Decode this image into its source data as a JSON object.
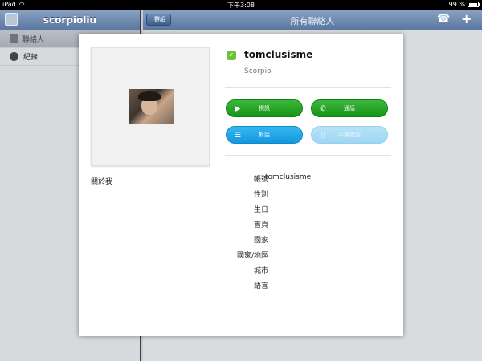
{
  "status_bar": {
    "device": "iPad",
    "time": "下午3:08",
    "battery": "99 %",
    "battery_level": 0.99
  },
  "left_pane": {
    "title": "scorpioliu",
    "items": [
      {
        "label": "聯絡人",
        "icon": "contacts-icon",
        "active": true
      },
      {
        "label": "紀錄",
        "icon": "clock-icon",
        "active": false
      }
    ]
  },
  "right_pane": {
    "back_label": "群組",
    "title": "所有聯絡人",
    "icons": [
      "phone-icon",
      "add-icon"
    ]
  },
  "profile": {
    "name": "tomclusisme",
    "mood": "Scorpio",
    "online_status_color": "#6ec23a",
    "about_label": "關於我",
    "buttons": [
      {
        "label": "視訊",
        "icon": "video-icon"
      },
      {
        "label": "通話",
        "icon": "phone-icon"
      },
      {
        "label": "對話",
        "icon": "chat-icon"
      },
      {
        "label": "手機撥話",
        "icon": "mobile-icon"
      }
    ],
    "fields": [
      {
        "label": "帳號",
        "value": "tomclusisme"
      },
      {
        "label": "性別",
        "value": ""
      },
      {
        "label": "生日",
        "value": ""
      },
      {
        "label": "首頁",
        "value": ""
      },
      {
        "label": "國家",
        "value": ""
      },
      {
        "label": "國家/地區",
        "value": ""
      },
      {
        "label": "城市",
        "value": ""
      },
      {
        "label": "語言",
        "value": ""
      }
    ]
  },
  "colors": {
    "accent_green": "#179317",
    "accent_blue": "#1398dc",
    "header_blue": "#5a77a0"
  }
}
